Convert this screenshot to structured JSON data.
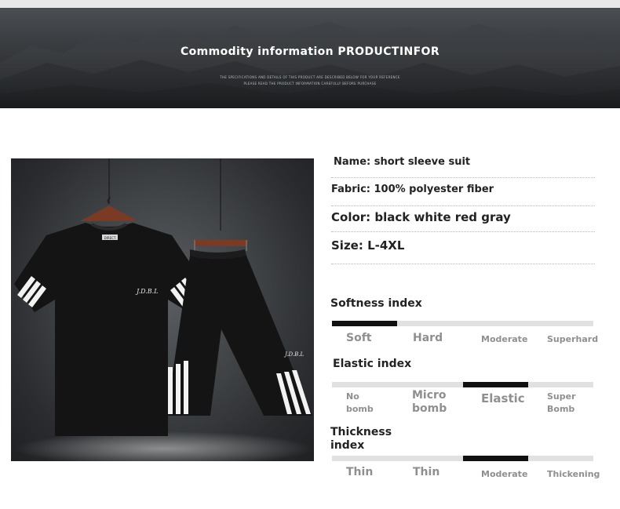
{
  "banner": {
    "title": "Commodity information PRODUCTINFOR",
    "subtitle_1": "THE SPECIFICATIONS AND DETAILS OF THIS PRODUCT ARE DESCRIBED BELOW FOR YOUR REFERENCE",
    "subtitle_2": "PLEASE READ THE PRODUCT INFORMATION CAREFULLY BEFORE PURCHASE"
  },
  "product": {
    "chest_print": "J.D.B.L",
    "shorts_print": "J.D.B.L",
    "neck_label": "DIRECT"
  },
  "specs": {
    "name": "Name: short sleeve suit",
    "fabric": "Fabric: 100% polyester fiber",
    "color": "Color: black white red gray",
    "size": "Size: L-4XL"
  },
  "indices": [
    {
      "title": "Softness index",
      "levels": [
        "Soft",
        "Hard",
        "Moderate",
        "Superhard"
      ],
      "selected_index": 0
    },
    {
      "title": "Elastic index",
      "levels": [
        "No bomb",
        "Micro bomb",
        "Elastic",
        "Super Bomb"
      ],
      "selected_index": 2
    },
    {
      "title": "Thickness index",
      "levels": [
        "Thin",
        "Thin",
        "Moderate",
        "Thickening"
      ],
      "selected_index": 2
    }
  ],
  "colors": {
    "banner_bg": "#2b2d31",
    "bar_track": "#e1e1e1",
    "bar_fill": "#111111",
    "level_text": "#8f8f8f"
  }
}
